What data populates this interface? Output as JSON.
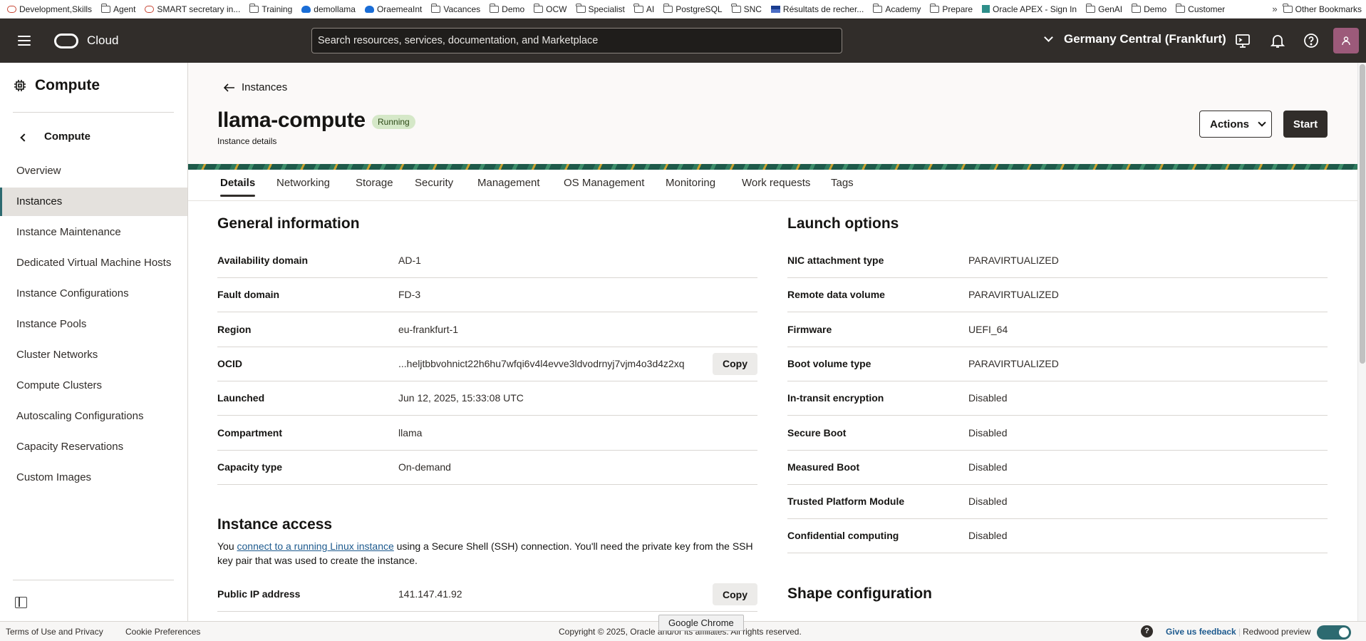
{
  "bookmarks": {
    "items": [
      {
        "label": "Development,Skills",
        "icon": "oracle-icon"
      },
      {
        "label": "Agent",
        "icon": "folder-icon"
      },
      {
        "label": "SMART secretary in...",
        "icon": "oracle-icon"
      },
      {
        "label": "Training",
        "icon": "folder-icon"
      },
      {
        "label": "demollama",
        "icon": "cloud-icon"
      },
      {
        "label": "OraemeaInt",
        "icon": "cloud-icon"
      },
      {
        "label": "Vacances",
        "icon": "folder-icon"
      },
      {
        "label": "Demo",
        "icon": "folder-icon"
      },
      {
        "label": "OCW",
        "icon": "folder-icon"
      },
      {
        "label": "Specialist",
        "icon": "folder-icon"
      },
      {
        "label": "AI",
        "icon": "folder-icon"
      },
      {
        "label": "PostgreSQL",
        "icon": "folder-icon"
      },
      {
        "label": "SNC",
        "icon": "folder-icon"
      },
      {
        "label": "Résultats de recher...",
        "icon": "flag-icon"
      },
      {
        "label": "Academy",
        "icon": "folder-icon"
      },
      {
        "label": "Prepare",
        "icon": "folder-icon"
      },
      {
        "label": "Oracle APEX - Sign In",
        "icon": "apex-icon"
      },
      {
        "label": "GenAI",
        "icon": "folder-icon"
      },
      {
        "label": "Demo",
        "icon": "folder-icon"
      },
      {
        "label": "Customer",
        "icon": "folder-icon"
      }
    ],
    "more": "»",
    "other": "Other Bookmarks"
  },
  "header": {
    "brand": "Cloud",
    "search_placeholder": "Search resources, services, documentation, and Marketplace",
    "region": "Germany Central (Frankfurt)"
  },
  "sidebar": {
    "title": "Compute",
    "back_label": "Compute",
    "items": [
      {
        "label": "Overview",
        "active": false
      },
      {
        "label": "Instances",
        "active": true
      },
      {
        "label": "Instance Maintenance",
        "active": false
      },
      {
        "label": "Dedicated Virtual Machine Hosts",
        "active": false
      },
      {
        "label": "Instance Configurations",
        "active": false
      },
      {
        "label": "Instance Pools",
        "active": false
      },
      {
        "label": "Cluster Networks",
        "active": false
      },
      {
        "label": "Compute Clusters",
        "active": false
      },
      {
        "label": "Autoscaling Configurations",
        "active": false
      },
      {
        "label": "Capacity Reservations",
        "active": false
      },
      {
        "label": "Custom Images",
        "active": false
      }
    ]
  },
  "page": {
    "breadcrumb": "Instances",
    "title": "llama-compute",
    "status": "Running",
    "subtitle": "Instance details",
    "actions_label": "Actions",
    "start_label": "Start"
  },
  "tabs": [
    "Details",
    "Networking",
    "Storage",
    "Security",
    "Management",
    "OS Management",
    "Monitoring",
    "Work requests",
    "Tags"
  ],
  "general": {
    "title": "General information",
    "rows": [
      {
        "label": "Availability domain",
        "value": "AD-1"
      },
      {
        "label": "Fault domain",
        "value": "FD-3"
      },
      {
        "label": "Region",
        "value": "eu-frankfurt-1"
      },
      {
        "label": "OCID",
        "value": "...heljtbbvohnict22h6hu7wfqi6v4l4evve3ldvodrnyj7vjm4o3d4z2xq",
        "copy": "Copy"
      },
      {
        "label": "Launched",
        "value": "Jun 12, 2025, 15:33:08 UTC"
      },
      {
        "label": "Compartment",
        "value": "llama"
      },
      {
        "label": "Capacity type",
        "value": "On-demand"
      }
    ]
  },
  "launch": {
    "title": "Launch options",
    "rows": [
      {
        "label": "NIC attachment type",
        "value": "PARAVIRTUALIZED"
      },
      {
        "label": "Remote data volume",
        "value": "PARAVIRTUALIZED"
      },
      {
        "label": "Firmware",
        "value": "UEFI_64"
      },
      {
        "label": "Boot volume type",
        "value": "PARAVIRTUALIZED"
      },
      {
        "label": "In-transit encryption",
        "value": "Disabled"
      },
      {
        "label": "Secure Boot",
        "value": "Disabled"
      },
      {
        "label": "Measured Boot",
        "value": "Disabled"
      },
      {
        "label": "Trusted Platform Module",
        "value": "Disabled"
      },
      {
        "label": "Confidential computing",
        "value": "Disabled"
      }
    ]
  },
  "access": {
    "title": "Instance access",
    "text_before": "You ",
    "link": "connect to a running Linux instance",
    "text_after": " using a Secure Shell (SSH) connection. You'll need the private key from the SSH key pair that was used to create the instance.",
    "ip_label": "Public IP address",
    "ip_value": "141.147.41.92",
    "copy": "Copy"
  },
  "shape": {
    "title": "Shape configuration"
  },
  "footer": {
    "terms": "Terms of Use and Privacy",
    "cookies": "Cookie Preferences",
    "copyright": "Copyright © 2025, Oracle and/or its affiliates. All rights reserved.",
    "feedback": "Give us feedback",
    "redwood": "Redwood preview",
    "help": "?"
  },
  "tooltip": "Google Chrome"
}
